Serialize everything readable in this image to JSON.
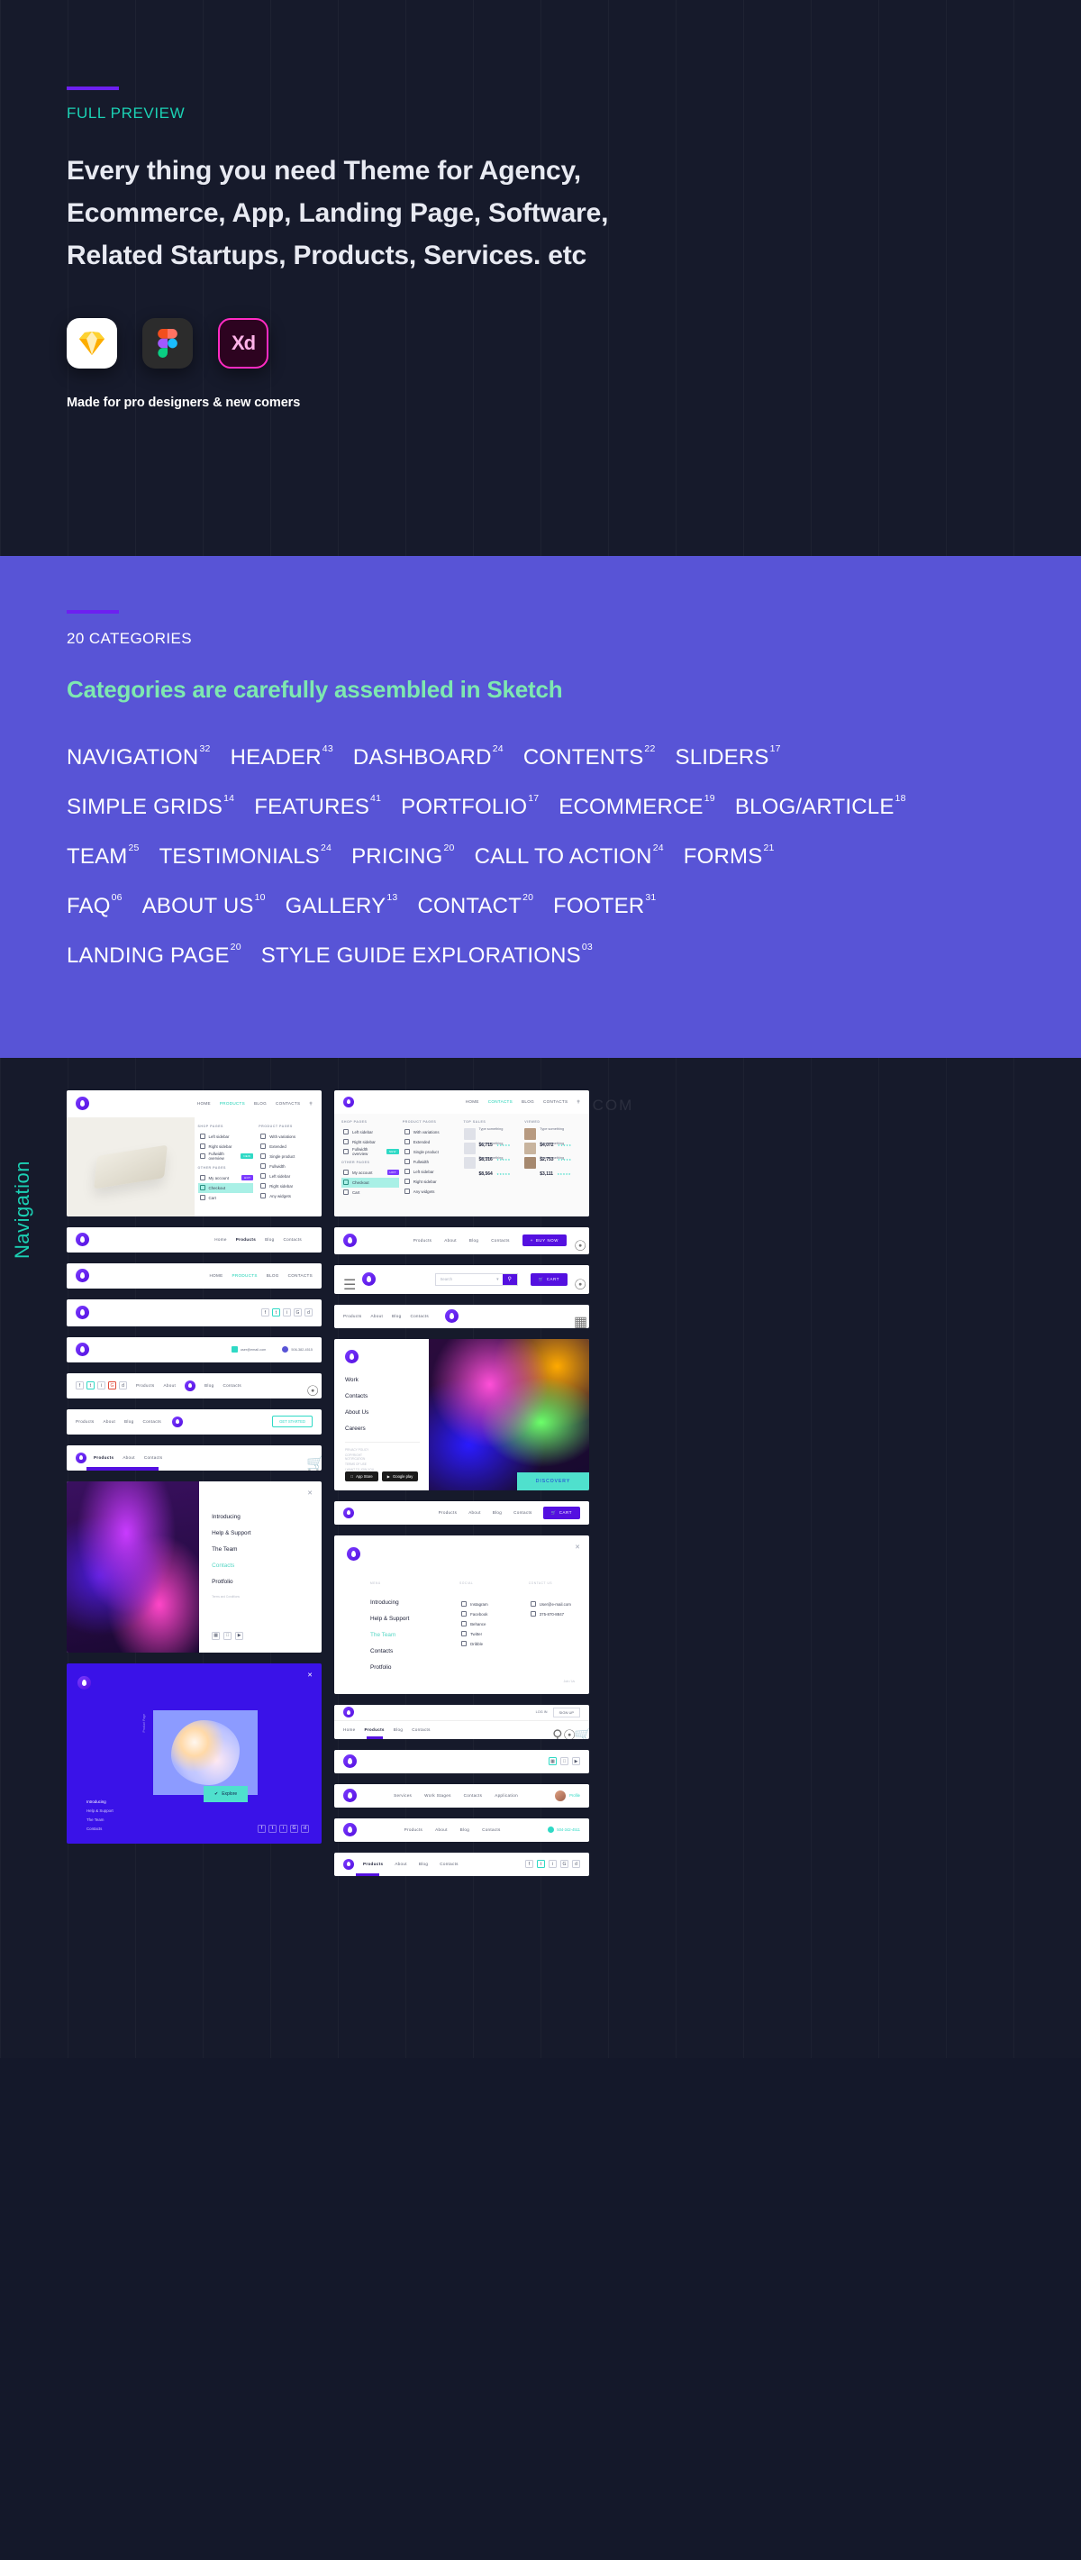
{
  "hero": {
    "eyebrow": "FULL PREVIEW",
    "headline": "Every thing you need Theme for Agency, Ecommerce, App, Landing Page, Software, Related Startups, Products, Services. etc",
    "apps": [
      {
        "name": "sketch-icon",
        "label": "Sketch"
      },
      {
        "name": "figma-icon",
        "label": "Figma"
      },
      {
        "name": "adobe-xd-icon",
        "label": "Xd"
      }
    ],
    "footnote": "Made for pro designers & new comers",
    "accent_purple": "#6d20f0",
    "accent_teal": "#1bd1b4",
    "background": "#161a2b"
  },
  "categories_section": {
    "eyebrow": "20 CATEGORIES",
    "heading": "Categories are carefully assembled in Sketch",
    "background": "#5854d6",
    "heading_color": "#7ee8b0",
    "rows": [
      [
        {
          "label": "NAVIGATION",
          "count": "32"
        },
        {
          "label": "HEADER",
          "count": "43"
        },
        {
          "label": "DASHBOARD",
          "count": "24"
        },
        {
          "label": "CONTENTS",
          "count": "22"
        },
        {
          "label": "SLIDERS",
          "count": "17"
        }
      ],
      [
        {
          "label": "SIMPLE GRIDS",
          "count": "14"
        },
        {
          "label": "FEATURES",
          "count": "41"
        },
        {
          "label": "PORTFOLIO",
          "count": "17"
        },
        {
          "label": "ECOMMERCE",
          "count": "19"
        },
        {
          "label": "BLOG/ARTICLE",
          "count": "18"
        }
      ],
      [
        {
          "label": "TEAM",
          "count": "25"
        },
        {
          "label": "TESTIMONIALS",
          "count": "24"
        },
        {
          "label": "PRICING",
          "count": "20"
        },
        {
          "label": "CALL TO ACTION",
          "count": "24"
        },
        {
          "label": "FORMS",
          "count": "21"
        }
      ],
      [
        {
          "label": "FAQ",
          "count": "06"
        },
        {
          "label": "ABOUT US",
          "count": "10"
        },
        {
          "label": "GALLERY",
          "count": "13"
        },
        {
          "label": "CONTACT",
          "count": "20"
        },
        {
          "label": "FOOTER",
          "count": "31"
        }
      ],
      [
        {
          "label": "LANDING PAGE",
          "count": "20"
        },
        {
          "label": "STYLE GUIDE EXPLORATIONS",
          "count": "03"
        }
      ]
    ]
  },
  "gallery": {
    "vertical_label": "Navigation",
    "watermark": "早道大咖 IAMDK.TAOBAO.COM",
    "watermark_mark": "Z",
    "mega_menu": {
      "nav": [
        "HOME",
        "PRODUCTS",
        "BLOG",
        "CONTACTS"
      ],
      "active_nav": "PRODUCTS",
      "col1_title": "SHOP PAGES",
      "col1_items": [
        "Left sidebar",
        "Right sidebar",
        "Fullwidth overview"
      ],
      "col1_tag": "NEW",
      "col2_title": "OTHER PAGES",
      "col2_items": [
        "My account",
        "Checkout",
        "Cart"
      ],
      "col2_tag": "HOT",
      "highlighted": "Checkout",
      "col3_title": "PRODUCT PAGES",
      "col3_items": [
        "With variations",
        "Extended",
        "Single product",
        "Fullwidth",
        "Left sidebar",
        "Right sidebar",
        "Any widgets"
      ]
    },
    "mega_menu_right": {
      "nav": [
        "HOME",
        "CONTACTS",
        "BLOG",
        "CONTACTS"
      ],
      "active_nav": "CONTACTS",
      "col1_title": "SHOP PAGES",
      "col1_items": [
        "Left sidebar",
        "Right sidebar",
        "Fullwidth overview"
      ],
      "col2_title": "OTHER PAGES",
      "col2_items": [
        "My account",
        "Checkout",
        "Cart"
      ],
      "col3_title": "PRODUCT PAGES",
      "col3_items": [
        "With variations",
        "Extended",
        "Single product",
        "Fullwidth",
        "Left sidebar",
        "Right sidebar",
        "Any widgets"
      ],
      "products_title": "TOP SALES",
      "products": [
        {
          "name": "Type something",
          "price": "$6,715"
        },
        {
          "name": "Type something",
          "price": "$8,316"
        },
        {
          "name": "Type something",
          "price": "$8,564"
        }
      ],
      "viewed_title": "VIEWED",
      "viewed": [
        {
          "name": "Type something",
          "price": "$4,072"
        },
        {
          "name": "Type something",
          "price": "$2,753"
        },
        {
          "name": "Type something",
          "price": "$3,111"
        }
      ]
    },
    "simple_navs": {
      "set_a": [
        "Home",
        "Products",
        "Blog",
        "Contacts"
      ],
      "set_b": [
        "Products",
        "About",
        "Blog",
        "Contacts"
      ],
      "set_c": [
        "Services",
        "Work Stages",
        "Contacts",
        "Application"
      ],
      "search_placeholder": "Search",
      "buy_now": "BUY NOW",
      "cart": "CART",
      "login": "LOG IN",
      "signup": "SIGN UP",
      "profile": "Profile",
      "get_started": "GET STARTED",
      "email": "user@email.com",
      "phone": "506-382-4515",
      "phone_alt": "504-342-4511"
    },
    "menu_panel_left": {
      "items": [
        "Introducing",
        "Help & Support",
        "The Team",
        "Contacts",
        "Protfolio"
      ],
      "active": "Contacts",
      "terms": "Terms and Conditions"
    },
    "menu_panel_wide": {
      "col_menu_title": "MENU",
      "col_social_title": "SOCIAL",
      "col_contact_title": "CONTACT US",
      "menu_items": [
        "Introducing",
        "Help & Support",
        "The Team",
        "Contacts",
        "Protfolio"
      ],
      "active": "The Team",
      "social": [
        "Instagram",
        "Facebook",
        "Behance",
        "Twitter",
        "Dribble"
      ],
      "contact_email": "User@e-mail.com",
      "contact_phone": "375-870-8847",
      "footer_note": "Join / Us"
    },
    "menu_panel_vertical": {
      "items": [
        "Work",
        "Contacts",
        "About Us",
        "Careers"
      ],
      "legal": [
        "PRIVACY POLICY",
        "COPYRIGHT NOTIFICATION",
        "TERMS OF USE",
        "I WANT TO JOIN YOU",
        "FIND A STORE"
      ],
      "app_store": "App Store",
      "google_play": "Google play",
      "discovery": "DISCOVERY"
    },
    "blue_panel": {
      "caption": "Product Page",
      "explore": "Explore",
      "items": [
        "Introducing",
        "Help & Support",
        "The Team",
        "Contacts"
      ]
    }
  }
}
